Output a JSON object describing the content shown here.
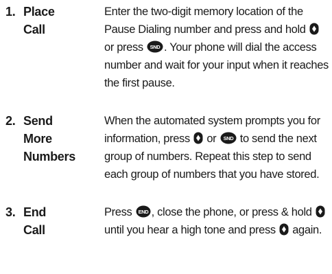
{
  "steps": [
    {
      "number": "1.",
      "title": [
        "Place",
        "Call"
      ],
      "text": {
        "a": "Enter the two-digit memory location of the Pause Dialing number and press and hold",
        "b": "or press",
        "c": ". Your phone will dial the access number and wait for your input when it reaches the first pause."
      }
    },
    {
      "number": "2.",
      "title": [
        "Send",
        "More",
        "Numbers"
      ],
      "text": {
        "a": "When the automated system prompts you for information, press",
        "b": "or",
        "c": "to send the next group of numbers. Repeat this step to send each group of numbers that you have stored."
      }
    },
    {
      "number": "3.",
      "title": [
        "End",
        "Call"
      ],
      "text": {
        "a": "Press",
        "b": ", close the phone, or press & hold",
        "c": "until you hear a high tone and press",
        "d": "again."
      }
    }
  ],
  "icons": {
    "nav_key": "nav-key-icon",
    "send_key": "send-key-icon",
    "end_key": "end-key-icon",
    "send_key_label": "SND",
    "end_key_label": "END"
  }
}
